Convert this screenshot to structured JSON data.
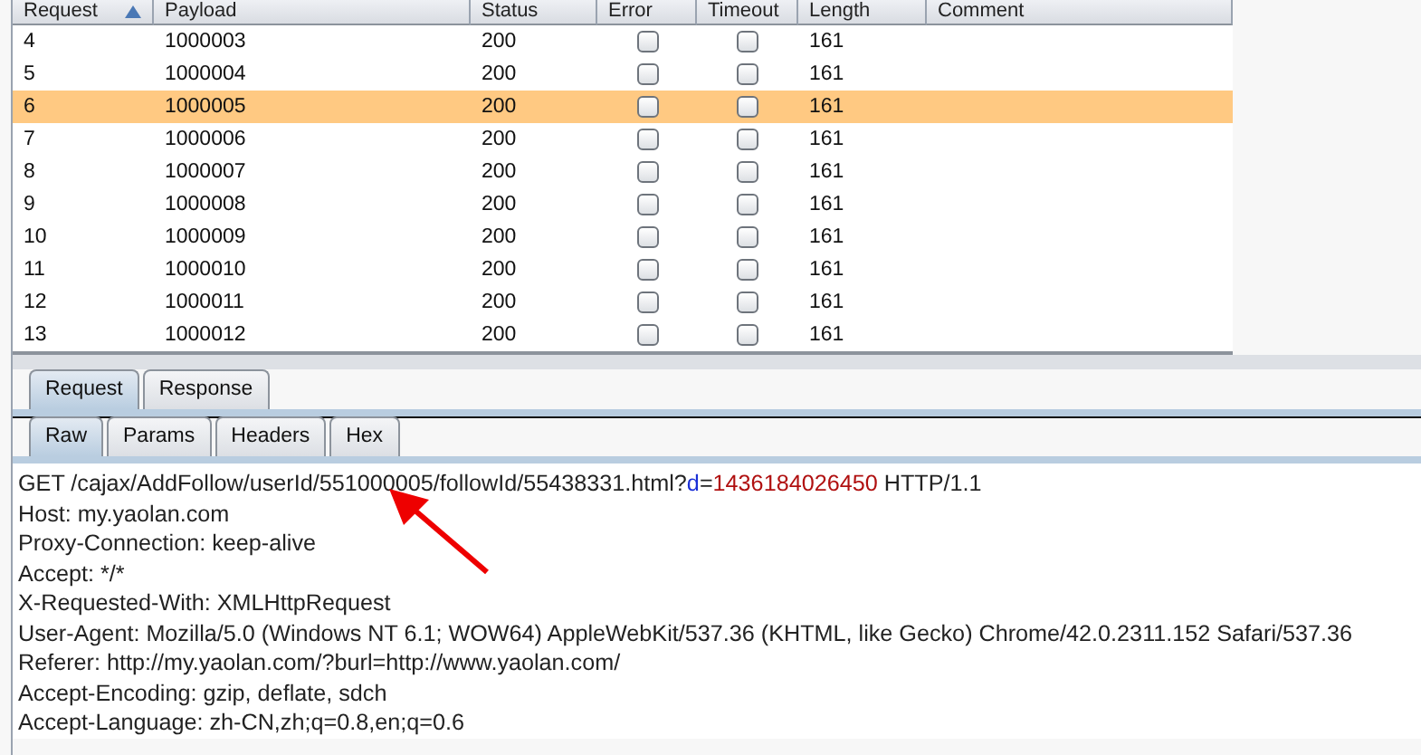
{
  "table": {
    "columns": [
      {
        "label": "Request",
        "sorted": true
      },
      {
        "label": "Payload",
        "sorted": false
      },
      {
        "label": "Status",
        "sorted": false
      },
      {
        "label": "Error",
        "sorted": false
      },
      {
        "label": "Timeout",
        "sorted": false
      },
      {
        "label": "Length",
        "sorted": false
      },
      {
        "label": "Comment",
        "sorted": false
      }
    ],
    "rows": [
      {
        "request": "4",
        "payload": "1000003",
        "status": "200",
        "error": false,
        "timeout": false,
        "length": "161",
        "selected": false
      },
      {
        "request": "5",
        "payload": "1000004",
        "status": "200",
        "error": false,
        "timeout": false,
        "length": "161",
        "selected": false
      },
      {
        "request": "6",
        "payload": "1000005",
        "status": "200",
        "error": false,
        "timeout": false,
        "length": "161",
        "selected": true
      },
      {
        "request": "7",
        "payload": "1000006",
        "status": "200",
        "error": false,
        "timeout": false,
        "length": "161",
        "selected": false
      },
      {
        "request": "8",
        "payload": "1000007",
        "status": "200",
        "error": false,
        "timeout": false,
        "length": "161",
        "selected": false
      },
      {
        "request": "9",
        "payload": "1000008",
        "status": "200",
        "error": false,
        "timeout": false,
        "length": "161",
        "selected": false
      },
      {
        "request": "10",
        "payload": "1000009",
        "status": "200",
        "error": false,
        "timeout": false,
        "length": "161",
        "selected": false
      },
      {
        "request": "11",
        "payload": "1000010",
        "status": "200",
        "error": false,
        "timeout": false,
        "length": "161",
        "selected": false
      },
      {
        "request": "12",
        "payload": "1000011",
        "status": "200",
        "error": false,
        "timeout": false,
        "length": "161",
        "selected": false
      },
      {
        "request": "13",
        "payload": "1000012",
        "status": "200",
        "error": false,
        "timeout": false,
        "length": "161",
        "selected": false
      }
    ]
  },
  "message_tabs": [
    {
      "label": "Request",
      "selected": true
    },
    {
      "label": "Response",
      "selected": false
    }
  ],
  "view_tabs": [
    {
      "label": "Raw",
      "selected": true
    },
    {
      "label": "Params",
      "selected": false
    },
    {
      "label": "Headers",
      "selected": false
    },
    {
      "label": "Hex",
      "selected": false
    }
  ],
  "editor": {
    "lines": [
      {
        "segments": [
          {
            "kind": "plain",
            "text": "GET /cajax/AddFollow/userId/551000005/followId/55438331.html?"
          },
          {
            "kind": "param_name",
            "text": "d"
          },
          {
            "kind": "plain",
            "text": "="
          },
          {
            "kind": "param_value",
            "text": "1436184026450"
          },
          {
            "kind": "plain",
            "text": " HTTP/1.1"
          }
        ]
      },
      {
        "segments": [
          {
            "kind": "plain",
            "text": "Host: my.yaolan.com"
          }
        ]
      },
      {
        "segments": [
          {
            "kind": "plain",
            "text": "Proxy-Connection: keep-alive"
          }
        ]
      },
      {
        "segments": [
          {
            "kind": "plain",
            "text": "Accept: */*"
          }
        ]
      },
      {
        "segments": [
          {
            "kind": "plain",
            "text": "X-Requested-With: XMLHttpRequest"
          }
        ]
      },
      {
        "segments": [
          {
            "kind": "plain",
            "text": "User-Agent: Mozilla/5.0 (Windows NT 6.1; WOW64) AppleWebKit/537.36 (KHTML, like Gecko) Chrome/42.0.2311.152 Safari/537.36"
          }
        ]
      },
      {
        "segments": [
          {
            "kind": "plain",
            "text": "Referer: http://my.yaolan.com/?burl=http://www.yaolan.com/"
          }
        ]
      },
      {
        "segments": [
          {
            "kind": "plain",
            "text": "Accept-Encoding: gzip, deflate, sdch"
          }
        ]
      },
      {
        "segments": [
          {
            "kind": "plain",
            "text": "Accept-Language: zh-CN,zh;q=0.8,en;q=0.6"
          }
        ]
      }
    ]
  }
}
